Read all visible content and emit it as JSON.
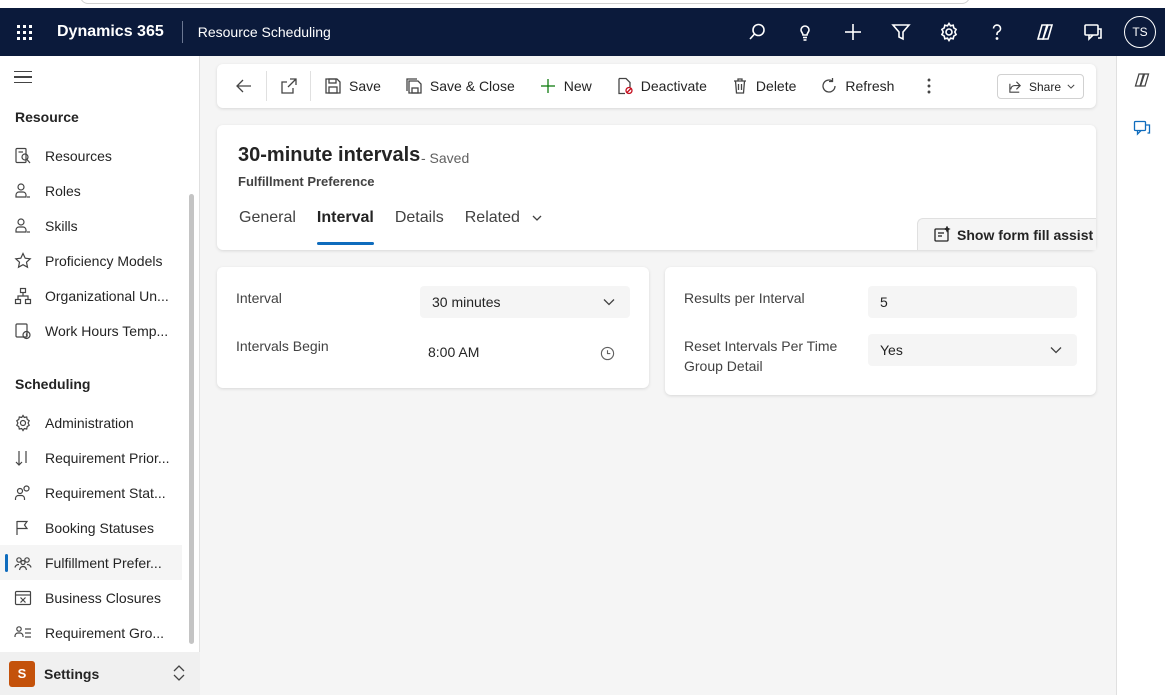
{
  "navbar": {
    "app_name": "Dynamics 365",
    "area_name": "Resource Scheduling",
    "user_initials": "TS"
  },
  "sidebar": {
    "groups": [
      {
        "title": "Resource"
      },
      {
        "title": "Scheduling"
      }
    ],
    "items": [
      {
        "label": "Resources",
        "icon": "resources-icon"
      },
      {
        "label": "Roles",
        "icon": "person-icon"
      },
      {
        "label": "Skills",
        "icon": "person-icon"
      },
      {
        "label": "Proficiency Models",
        "icon": "star-icon"
      },
      {
        "label": "Organizational Un...",
        "icon": "org-chart-icon"
      },
      {
        "label": "Work Hours Temp...",
        "icon": "calendar-clock-icon"
      },
      {
        "label": "Administration",
        "icon": "gear-icon"
      },
      {
        "label": "Requirement Prior...",
        "icon": "sort-arrows-icon"
      },
      {
        "label": "Requirement Stat...",
        "icon": "people-status-icon"
      },
      {
        "label": "Booking Statuses",
        "icon": "flag-icon"
      },
      {
        "label": "Fulfillment Prefer...",
        "icon": "people-team-icon"
      },
      {
        "label": "Business Closures",
        "icon": "calendar-cancel-icon"
      },
      {
        "label": "Requirement Gro...",
        "icon": "person-list-icon"
      }
    ],
    "active_item": "Fulfillment Prefer...",
    "area_switcher": {
      "badge": "S",
      "label": "Settings"
    }
  },
  "command_bar": {
    "save": "Save",
    "save_close": "Save & Close",
    "new": "New",
    "deactivate": "Deactivate",
    "delete": "Delete",
    "refresh": "Refresh",
    "share": "Share"
  },
  "record": {
    "title": "30-minute intervals",
    "status": "- Saved",
    "entity": "Fulfillment Preference",
    "tabs": [
      "General",
      "Interval",
      "Details",
      "Related"
    ],
    "active_tab": "Interval",
    "form_fill_assist": "Show form fill assist"
  },
  "form": {
    "interval": {
      "label": "Interval",
      "value": "30 minutes"
    },
    "intervals_begin": {
      "label": "Intervals Begin",
      "value": "8:00 AM"
    },
    "results_per_interval": {
      "label": "Results per Interval",
      "value": "5"
    },
    "reset_intervals": {
      "label_line1": "Reset Intervals Per Time",
      "label_line2": "Group Detail",
      "value": "Yes"
    }
  },
  "colors": {
    "navbar_bg": "#0b1a3b",
    "accent": "#0f6cbd",
    "area_badge": "#c4520b"
  }
}
